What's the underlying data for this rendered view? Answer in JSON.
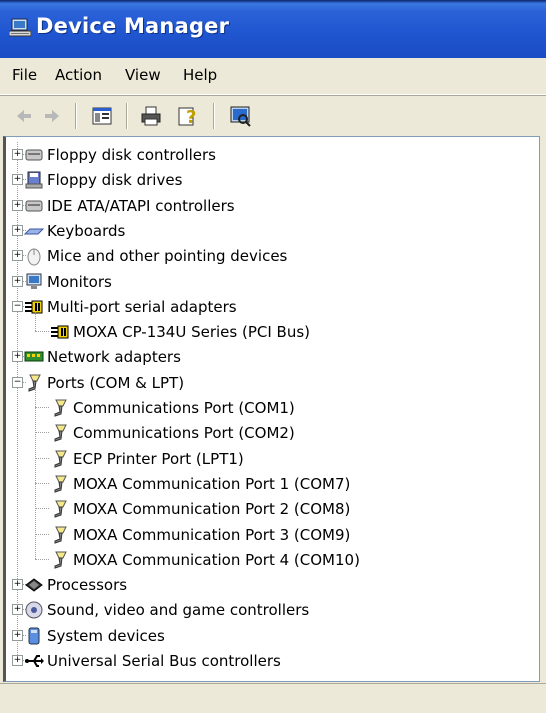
{
  "window": {
    "title": "Device Manager"
  },
  "menu": {
    "file": "File",
    "action": "Action",
    "view": "View",
    "help": "Help"
  },
  "toolbar": {
    "back_icon": "back-arrow-icon",
    "forward_icon": "forward-arrow-icon",
    "properties_icon": "properties-icon",
    "print_icon": "printer-icon",
    "help_icon": "help-icon",
    "scan_icon": "scan-hardware-icon"
  },
  "tree": {
    "items": [
      {
        "label": "Floppy disk controllers",
        "icon": "disk-controller-icon",
        "expanded": false
      },
      {
        "label": "Floppy disk drives",
        "icon": "floppy-drive-icon",
        "expanded": false
      },
      {
        "label": "IDE ATA/ATAPI controllers",
        "icon": "ide-controller-icon",
        "expanded": false
      },
      {
        "label": "Keyboards",
        "icon": "keyboard-icon",
        "expanded": false
      },
      {
        "label": "Mice and other pointing devices",
        "icon": "mouse-icon",
        "expanded": false
      },
      {
        "label": "Monitors",
        "icon": "monitor-icon",
        "expanded": false
      },
      {
        "label": "Multi-port serial adapters",
        "icon": "serial-adapter-icon",
        "expanded": true,
        "children": [
          {
            "label": "MOXA CP-134U Series (PCI Bus)",
            "icon": "serial-adapter-icon"
          }
        ]
      },
      {
        "label": "Network adapters",
        "icon": "network-adapter-icon",
        "expanded": false
      },
      {
        "label": "Ports (COM & LPT)",
        "icon": "port-icon",
        "expanded": true,
        "children": [
          {
            "label": "Communications Port (COM1)",
            "icon": "port-icon"
          },
          {
            "label": "Communications Port (COM2)",
            "icon": "port-icon"
          },
          {
            "label": "ECP Printer Port (LPT1)",
            "icon": "port-icon"
          },
          {
            "label": "MOXA Communication Port 1 (COM7)",
            "icon": "port-icon"
          },
          {
            "label": "MOXA Communication Port 2 (COM8)",
            "icon": "port-icon"
          },
          {
            "label": "MOXA Communication Port 3 (COM9)",
            "icon": "port-icon"
          },
          {
            "label": "MOXA Communication Port 4 (COM10)",
            "icon": "port-icon"
          }
        ]
      },
      {
        "label": "Processors",
        "icon": "processor-icon",
        "expanded": false
      },
      {
        "label": "Sound, video and game controllers",
        "icon": "sound-icon",
        "expanded": false
      },
      {
        "label": "System devices",
        "icon": "system-devices-icon",
        "expanded": false
      },
      {
        "label": "Universal Serial Bus controllers",
        "icon": "usb-icon",
        "expanded": false
      }
    ]
  },
  "status": {
    "text": ""
  }
}
